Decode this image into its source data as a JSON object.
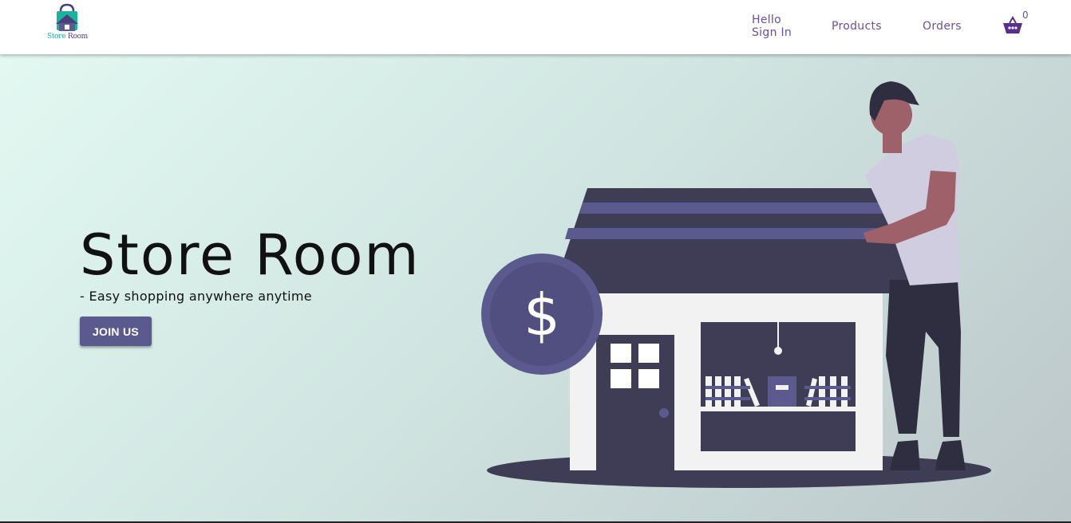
{
  "brand": {
    "logo_text_part1": "Store",
    "logo_text_part2": "Room",
    "accent_color": "#5b5a8e",
    "logo_teal": "#19b39e"
  },
  "nav": {
    "greeting": "Hello",
    "signin": "Sign In",
    "products": "Products",
    "orders": "Orders",
    "basket_icon": "basket-icon",
    "basket_count": "0",
    "link_color": "#6b4f9a"
  },
  "hero": {
    "title": "Store Room",
    "subtitle": "- Easy shopping anywhere anytime",
    "cta": "JOIN US",
    "illustration_icons": [
      "store-icon",
      "dollar-coin-icon",
      "person-icon"
    ],
    "coin_symbol": "$"
  }
}
